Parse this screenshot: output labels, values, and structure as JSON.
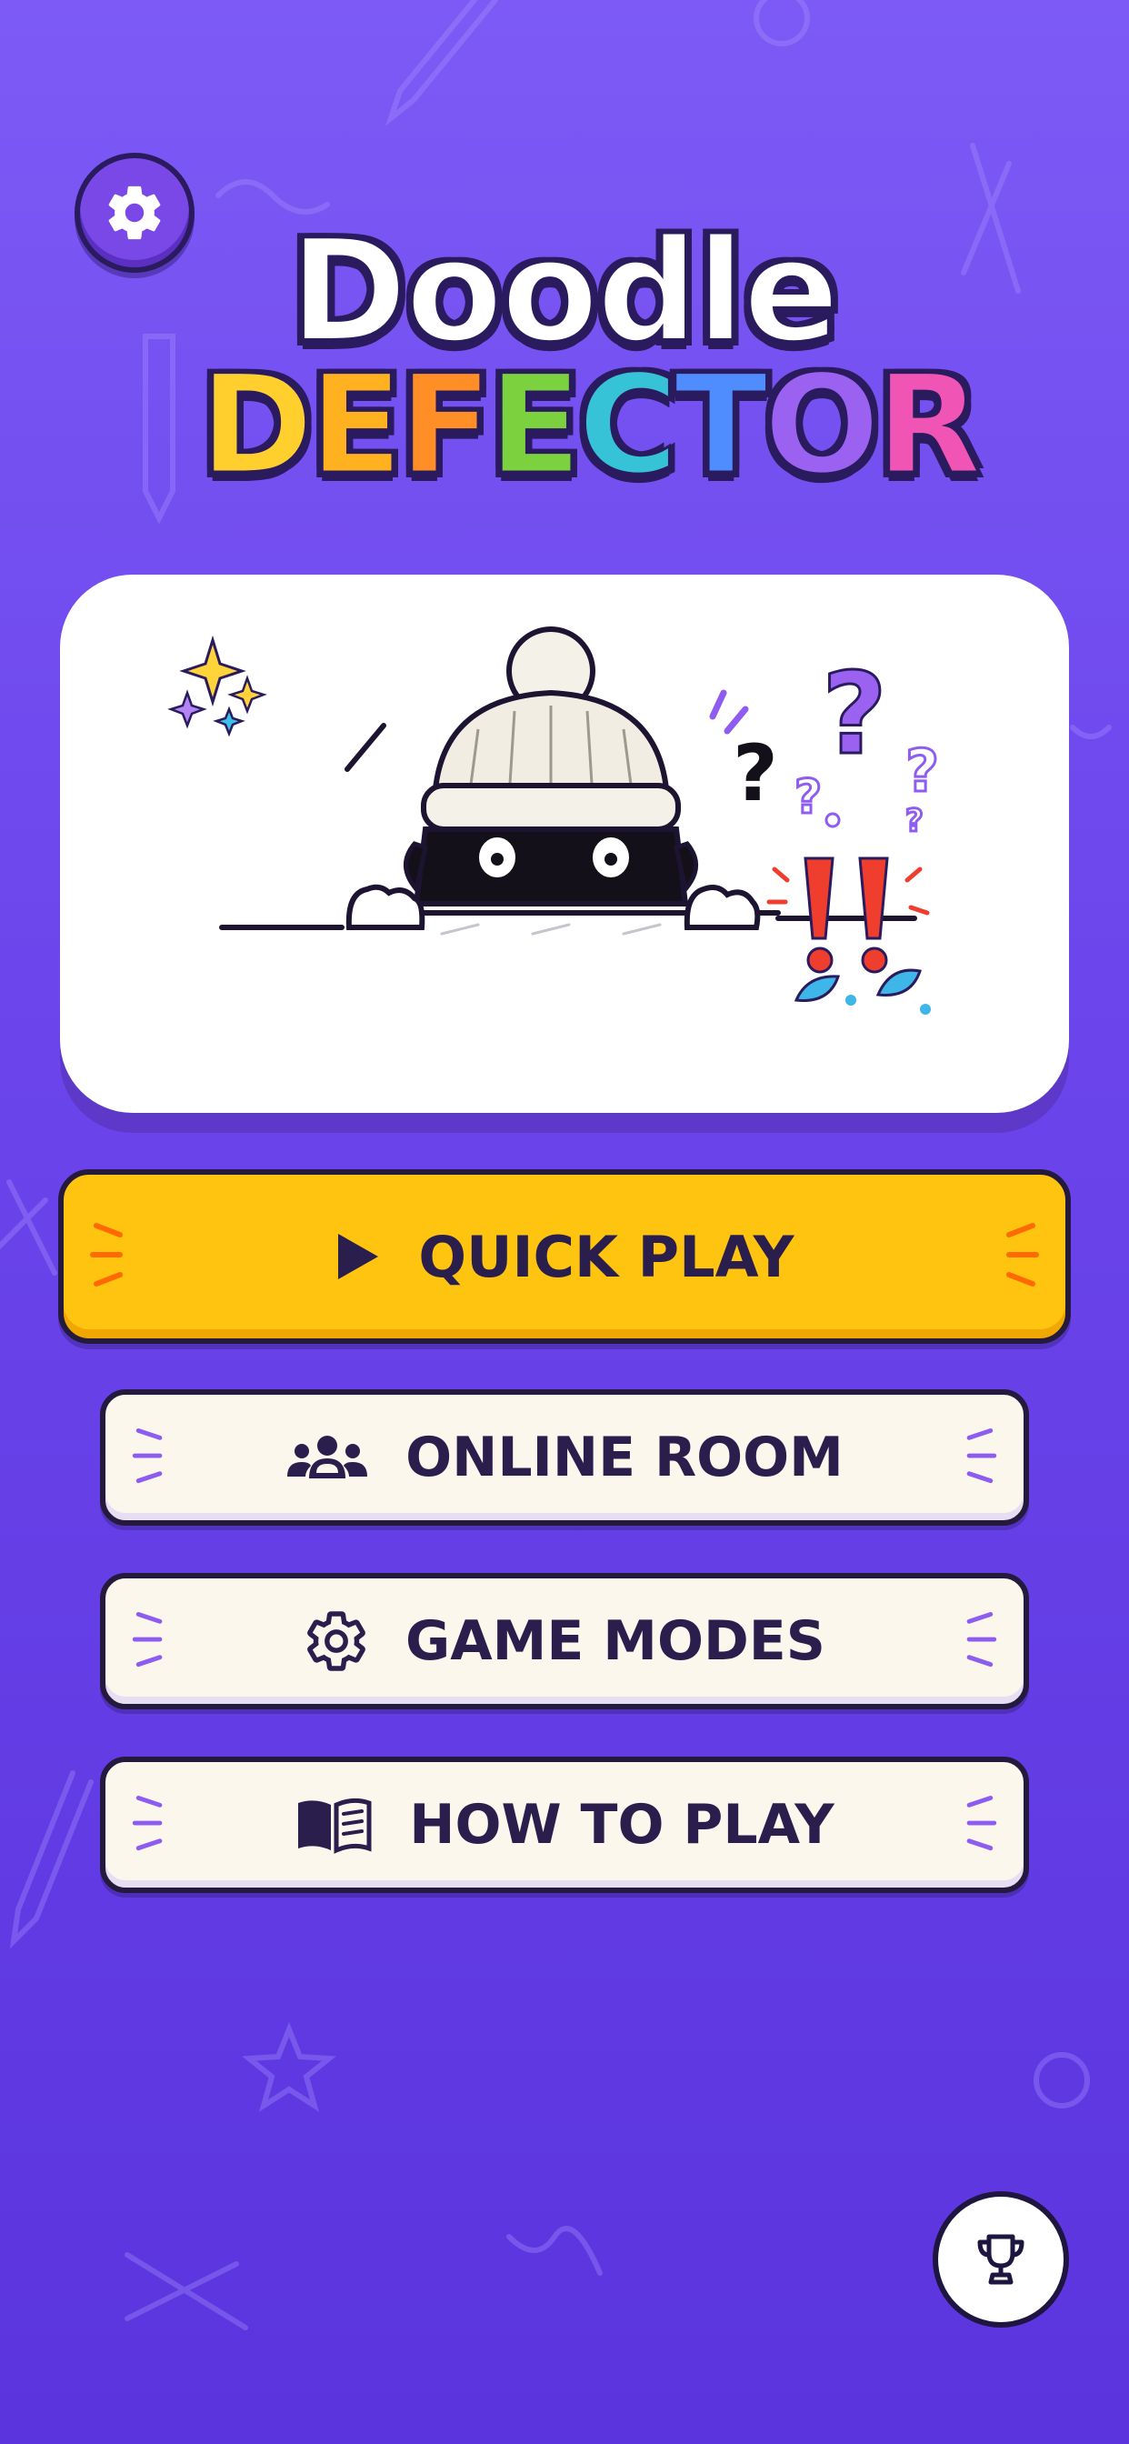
{
  "header": {
    "settings_icon": "gear-icon"
  },
  "logo": {
    "line1": "Doodle",
    "line2_letters": [
      {
        "char": "D",
        "color": "#ffcf2e"
      },
      {
        "char": "E",
        "color": "#ffb11f"
      },
      {
        "char": "F",
        "color": "#ff8e27"
      },
      {
        "char": "E",
        "color": "#7bd23e"
      },
      {
        "char": "C",
        "color": "#36c3d8"
      },
      {
        "char": "T",
        "color": "#4f8dff"
      },
      {
        "char": "O",
        "color": "#9b62f2"
      },
      {
        "char": "R",
        "color": "#f055b5"
      }
    ]
  },
  "hero": {
    "illustration": "thief-peeking-over-wall",
    "colors": {
      "exclamation": "#ef3d2e",
      "question": "#8e5cf0",
      "splash": "#3fb6e8"
    }
  },
  "menu": {
    "quick_play": {
      "label": "QUICK PLAY",
      "icon": "play-icon"
    },
    "online_room": {
      "label": "ONLINE ROOM",
      "icon": "group-icon"
    },
    "game_modes": {
      "label": "GAME MODES",
      "icon": "gear-icon"
    },
    "how_to_play": {
      "label": "HOW TO PLAY",
      "icon": "book-icon"
    }
  },
  "footer": {
    "trophy_icon": "trophy-icon"
  },
  "colors": {
    "background_top": "#7d5af5",
    "background_bottom": "#5b34de",
    "primary_button": "#ffc410",
    "secondary_button": "#fbf7ec",
    "text_dark": "#2a1e4c"
  }
}
